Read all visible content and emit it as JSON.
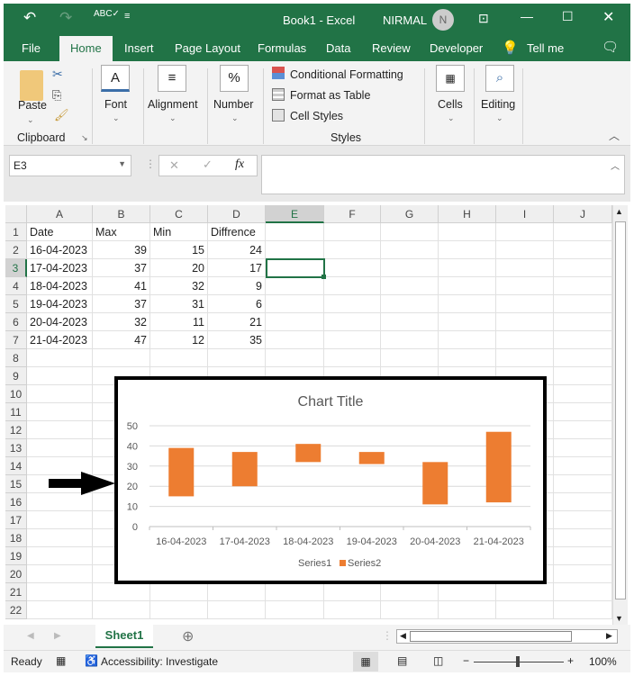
{
  "titlebar": {
    "title": "Book1  -  Excel",
    "user": "NIRMAL",
    "avatar": "N"
  },
  "tabs": [
    "File",
    "Home",
    "Insert",
    "Page Layout",
    "Formulas",
    "Data",
    "Review",
    "Developer",
    "Tell me"
  ],
  "ribbon": {
    "paste": "Paste",
    "clipboard": "Clipboard",
    "font": "Font",
    "alignment": "Alignment",
    "number": "Number",
    "cond_format": "Conditional Formatting",
    "format_table": "Format as Table",
    "cell_styles": "Cell Styles",
    "styles": "Styles",
    "cells": "Cells",
    "editing": "Editing",
    "number_icon": "%"
  },
  "formula_bar": {
    "name_box": "E3",
    "formula": ""
  },
  "columns": [
    "A",
    "B",
    "C",
    "D",
    "E",
    "F",
    "G",
    "H",
    "I",
    "J"
  ],
  "rows": [
    [
      "Date",
      "Max",
      "Min",
      "Diffrence"
    ],
    [
      "16-04-2023",
      "39",
      "15",
      "24"
    ],
    [
      "17-04-2023",
      "37",
      "20",
      "17"
    ],
    [
      "18-04-2023",
      "41",
      "32",
      "9"
    ],
    [
      "19-04-2023",
      "37",
      "31",
      "6"
    ],
    [
      "20-04-2023",
      "32",
      "11",
      "21"
    ],
    [
      "21-04-2023",
      "47",
      "12",
      "35"
    ]
  ],
  "row_numbers": [
    "1",
    "2",
    "3",
    "4",
    "5",
    "6",
    "7",
    "8",
    "9",
    "10",
    "11",
    "12",
    "13",
    "14",
    "15",
    "16",
    "17",
    "18",
    "19",
    "20",
    "21",
    "22"
  ],
  "sheet_tab": "Sheet1",
  "status": {
    "ready": "Ready",
    "accessibility": "Accessibility: Investigate",
    "zoom": "100%"
  },
  "chart_data": {
    "type": "bar",
    "stacked": true,
    "title": "Chart Title",
    "categories": [
      "16-04-2023",
      "17-04-2023",
      "18-04-2023",
      "19-04-2023",
      "20-04-2023",
      "21-04-2023"
    ],
    "series": [
      {
        "name": "Series1",
        "values": [
          15,
          20,
          32,
          31,
          11,
          12
        ],
        "color": "none"
      },
      {
        "name": "Series2",
        "values": [
          24,
          17,
          9,
          6,
          21,
          35
        ],
        "color": "#ed7d31"
      }
    ],
    "yticks": [
      "0",
      "10",
      "20",
      "30",
      "40",
      "50"
    ],
    "ylim": [
      0,
      50
    ],
    "legend": "bottom",
    "grid": true
  }
}
